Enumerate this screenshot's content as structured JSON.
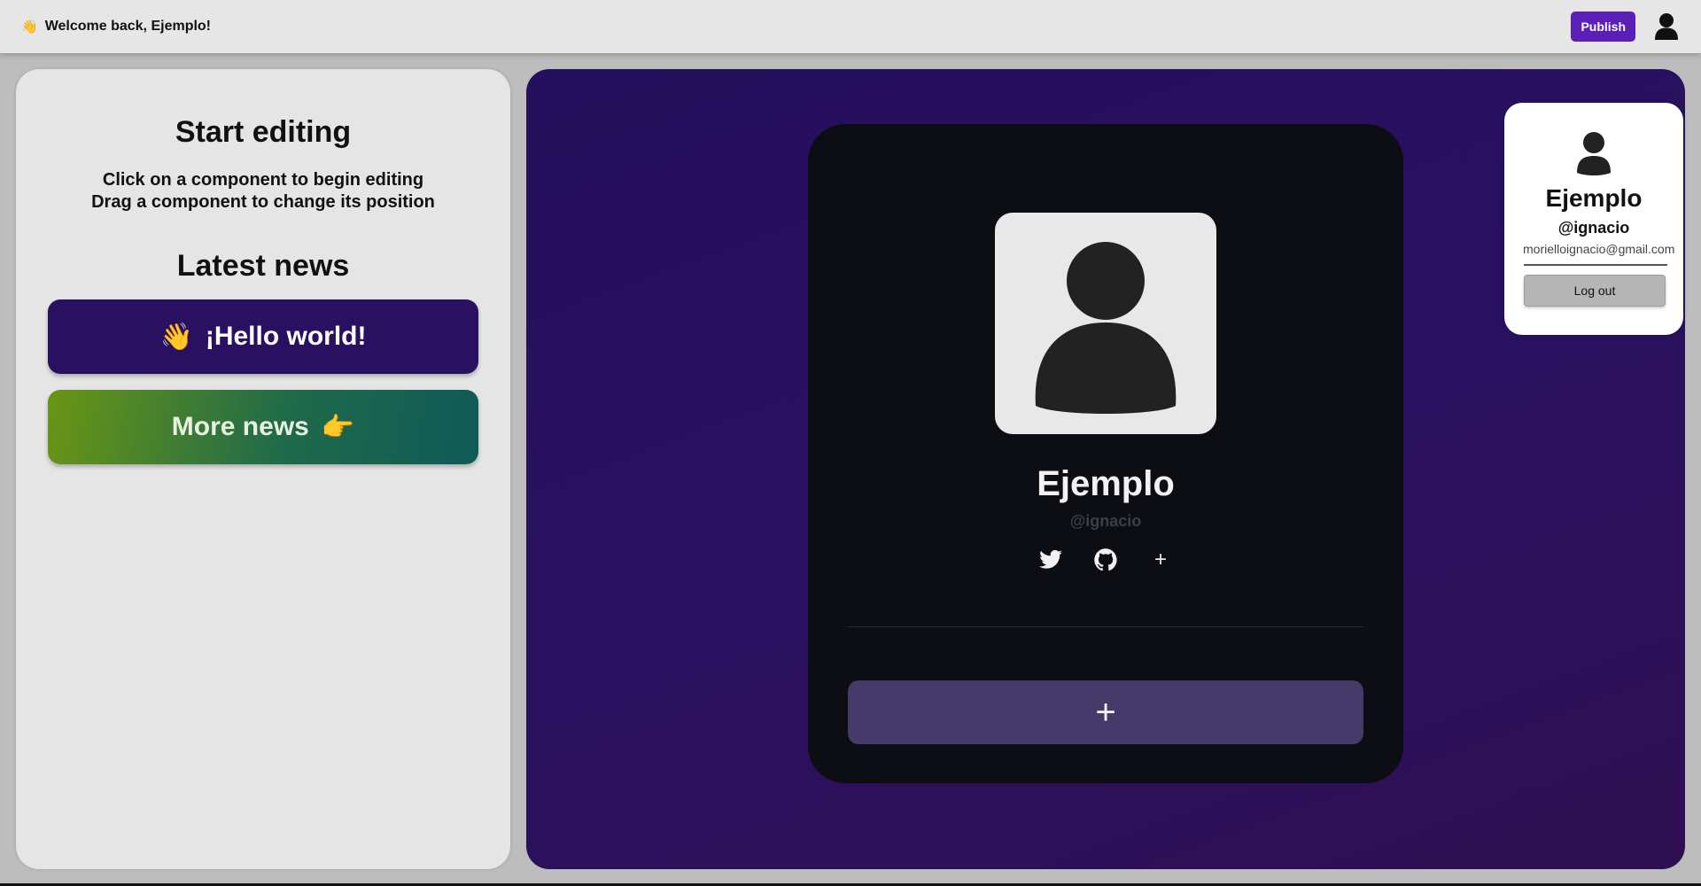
{
  "header": {
    "wave_emoji": "👋",
    "welcome_text": "Welcome back, Ejemplo!",
    "publish_label": "Publish",
    "avatar_icon": "user-avatar-icon"
  },
  "sidebar": {
    "title": "Start editing",
    "instruction_1": "Click on a component to begin editing",
    "instruction_2": "Drag a component to change its position",
    "news_title": "Latest news",
    "news_items": [
      {
        "emoji": "👋",
        "label": "¡Hello world!"
      },
      {
        "label": "More news",
        "emoji": "👉"
      }
    ]
  },
  "profile": {
    "name": "Ejemplo",
    "handle": "@ignacio",
    "socials": [
      "twitter-icon",
      "github-icon"
    ],
    "add_social_label": "+",
    "add_block_label": "+"
  },
  "account_menu": {
    "name": "Ejemplo",
    "handle": "@ignacio",
    "email": "morielloignacio@gmail.com",
    "logout_label": "Log out"
  },
  "colors": {
    "accent": "#5b1fb8",
    "stage_bg": "#2a1160",
    "card_bg": "#0d0d14",
    "add_block_bg": "#463a6b"
  }
}
